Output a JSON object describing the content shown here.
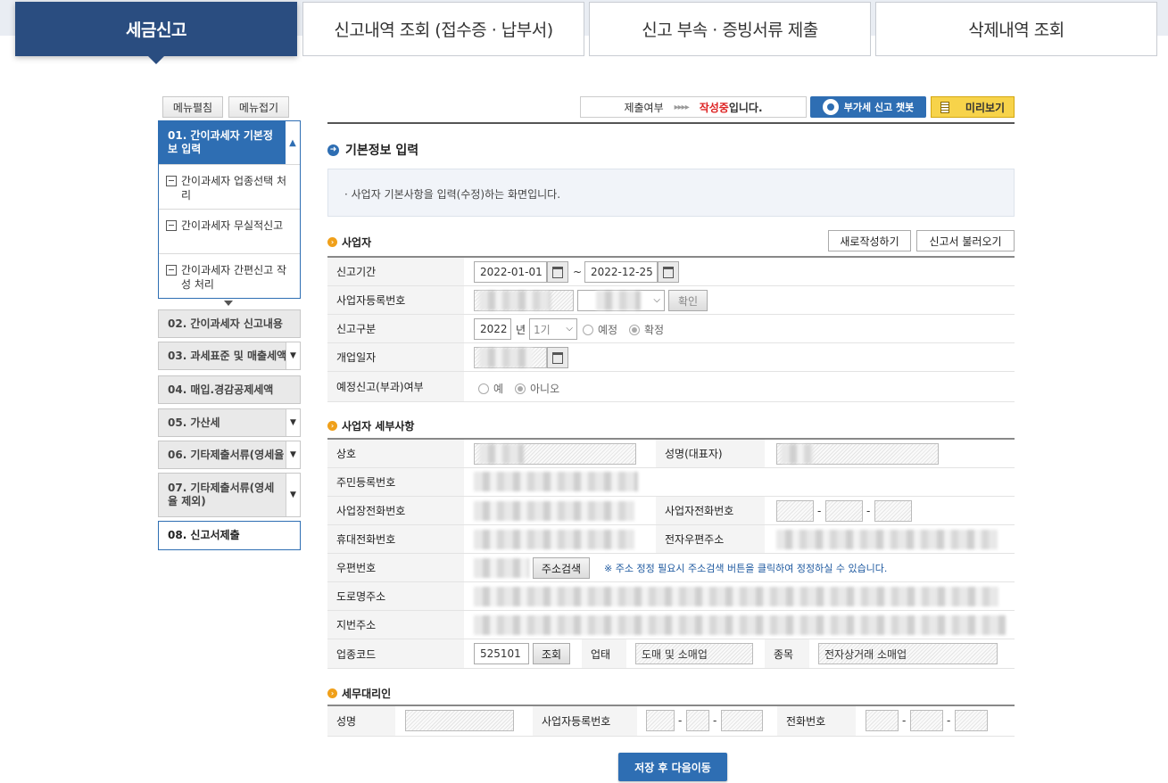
{
  "tabs": [
    {
      "label": "세금신고"
    },
    {
      "label": "신고내역 조회 (접수증 · 납부서)"
    },
    {
      "label": "신고 부속 · 증빙서류 제출"
    },
    {
      "label": "삭제내역 조회"
    }
  ],
  "left_nav": {
    "expand_label": "메뉴펼침",
    "collapse_label": "메뉴접기",
    "active_group": {
      "label": "01. 간이과세자 기본정보 입력",
      "subitems": [
        {
          "label": "간이과세자 업종선택 처리"
        },
        {
          "label": "간이과세자 무실적신고"
        },
        {
          "label": "간이과세자 간편신고 작성 처리"
        }
      ]
    },
    "items": [
      {
        "label": "02. 간이과세자 신고내용"
      },
      {
        "label": "03. 과세표준 및 매출세액"
      },
      {
        "label": "04. 매입.경감공제세액"
      },
      {
        "label": "05. 가산세"
      },
      {
        "label": "06. 기타제출서류(영세율"
      },
      {
        "label": "07. 기타제출서류(영세율 제외)"
      },
      {
        "label": "08. 신고서제출"
      }
    ]
  },
  "status_bar": {
    "label": "제출여부",
    "arrows": "▸▸▸▸",
    "status_red": "작성중",
    "status_suffix": "입니다.",
    "chatbot_label": "부가세 신고 챗봇",
    "preview_label": "미리보기"
  },
  "section": {
    "title": "기본정보 입력",
    "info": "· 사업자 기본사항을 입력(수정)하는 화면입니다."
  },
  "business": {
    "title": "사업자",
    "new_button": "새로작성하기",
    "load_button": "신고서 불러오기",
    "period_label": "신고기간",
    "period_start": "2022-01-01",
    "period_tilde": "~",
    "period_end": "2022-12-25",
    "regno_label": "사업자등록번호",
    "confirm_button": "확인",
    "type_label": "신고구분",
    "year": "2022",
    "year_unit": "년",
    "term": "1기",
    "radio_preliminary": "예정",
    "radio_final": "확정",
    "open_date_label": "개업일자",
    "prelim_label": "예정신고(부과)여부",
    "radio_yes": "예",
    "radio_no": "아니오"
  },
  "detail": {
    "title": "사업자 세부사항",
    "company_label": "상호",
    "rep_label": "성명(대표자)",
    "resident_label": "주민등록번호",
    "biz_phone_label": "사업장전화번호",
    "biz_tel_label": "사업자전화번호",
    "dash": "-",
    "mobile_label": "휴대전화번호",
    "email_label": "전자우편주소",
    "zip_label": "우편번호",
    "zip_search_button": "주소검색",
    "zip_note": "※ 주소 정정 필요시 주소검색 버튼을 클릭하여 정정하실 수 있습니다.",
    "road_label": "도로명주소",
    "lot_label": "지번주소",
    "industry_label": "업종코드",
    "industry_code": "525101",
    "lookup_button": "조회",
    "biz_type_label": "업태",
    "biz_type_value": "도매 및 소매업",
    "item_label": "종목",
    "item_value": "전자상거래 소매업"
  },
  "agent": {
    "title": "세무대리인",
    "name_label": "성명",
    "regno_label": "사업자등록번호",
    "phone_label": "전화번호"
  },
  "save_button": "저장 후 다음이동"
}
